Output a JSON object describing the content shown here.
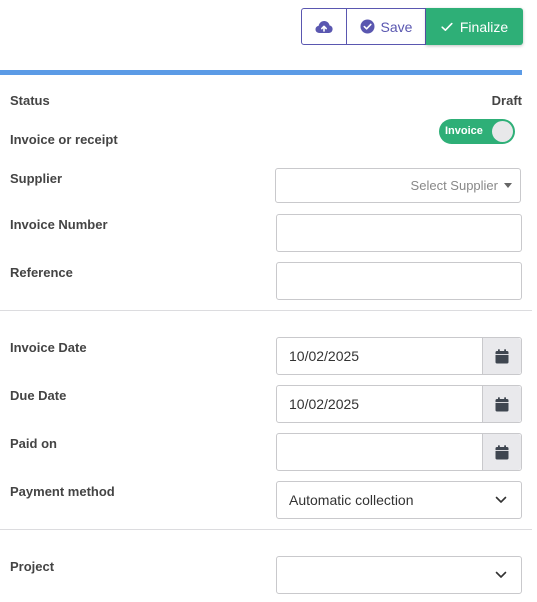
{
  "toolbar": {
    "upload_icon": "cloud-upload-icon",
    "save_label": "Save",
    "finalize_label": "Finalize"
  },
  "colors": {
    "primary": "#5a57b0",
    "success": "#2eaf77",
    "accent_bar": "#5b9be6"
  },
  "form": {
    "status": {
      "label": "Status",
      "value": "Draft"
    },
    "invoice_or_receipt": {
      "label": "Invoice or receipt",
      "toggle_label": "Invoice",
      "on": true
    },
    "supplier": {
      "label": "Supplier",
      "placeholder": "Select Supplier"
    },
    "invoice_number": {
      "label": "Invoice Number",
      "value": ""
    },
    "reference": {
      "label": "Reference",
      "value": ""
    },
    "invoice_date": {
      "label": "Invoice Date",
      "value": "10/02/2025"
    },
    "due_date": {
      "label": "Due Date",
      "value": "10/02/2025"
    },
    "paid_on": {
      "label": "Paid on",
      "value": ""
    },
    "payment_method": {
      "label": "Payment method",
      "value": "Automatic collection"
    },
    "project": {
      "label": "Project",
      "value": ""
    }
  }
}
